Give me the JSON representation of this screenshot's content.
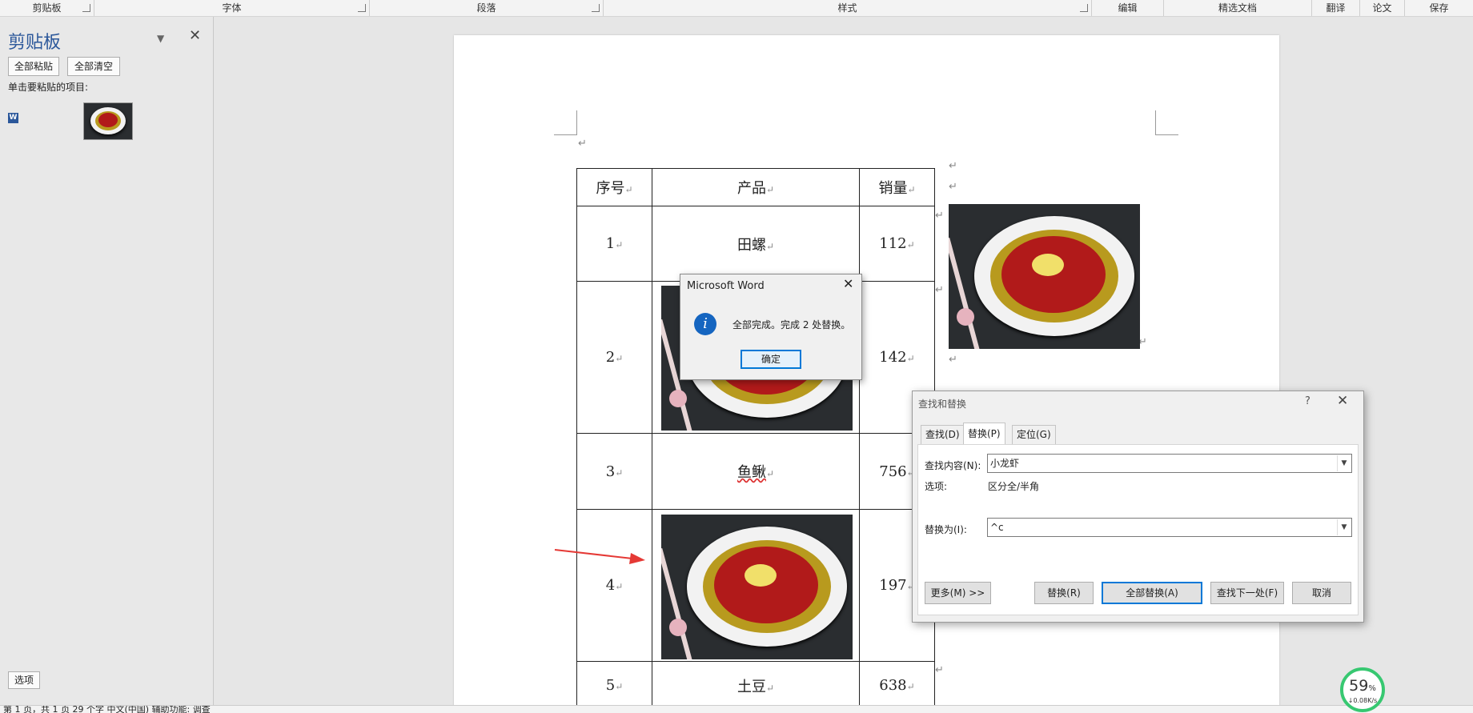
{
  "ribbon": {
    "groups": [
      "剪贴板",
      "字体",
      "段落",
      "样式",
      "编辑",
      "精选文档",
      "翻译",
      "论文",
      "保存"
    ]
  },
  "clipboard_pane": {
    "title": "剪贴板",
    "paste_all": "全部粘贴",
    "clear_all": "全部清空",
    "hint": "单击要粘贴的项目:",
    "options": "选项"
  },
  "table": {
    "headers": [
      "序号",
      "产品",
      "销量"
    ],
    "rows": [
      {
        "no": "1",
        "product": "田螺",
        "sales": "112"
      },
      {
        "no": "2",
        "product": "",
        "sales": "142"
      },
      {
        "no": "3",
        "product": "鱼鳅",
        "sales": "756"
      },
      {
        "no": "4",
        "product": "",
        "sales": "197"
      },
      {
        "no": "5",
        "product": "土豆",
        "sales": "638"
      }
    ],
    "return_mark": "↵"
  },
  "message_box": {
    "title": "Microsoft Word",
    "text": "全部完成。完成 2 处替换。",
    "ok": "确定"
  },
  "find_replace": {
    "title": "查找和替换",
    "help": "?",
    "tabs": [
      "查找(D)",
      "替换(P)",
      "定位(G)"
    ],
    "active_tab": "替换(P)",
    "find_label": "查找内容(N):",
    "find_value": "小龙虾",
    "options_label": "选项:",
    "options_value": "区分全/半角",
    "replace_label": "替换为(I):",
    "replace_value": "^c",
    "buttons": {
      "more": "更多(M) >>",
      "replace": "替换(R)",
      "replace_all": "全部替换(A)",
      "find_next": "查找下一处(F)",
      "cancel": "取消"
    }
  },
  "status_bar": {
    "text": "第 1 页，共 1 页    29 个字    中文(中国)    辅助功能: 调查"
  },
  "network_widget": {
    "percent": "59",
    "unit": "%",
    "speed": "↓0.08K/s",
    "color": "#37c871"
  },
  "colors": {
    "accent": "#0078d7",
    "pane_title": "#2b579a",
    "arrow": "#e53935"
  }
}
